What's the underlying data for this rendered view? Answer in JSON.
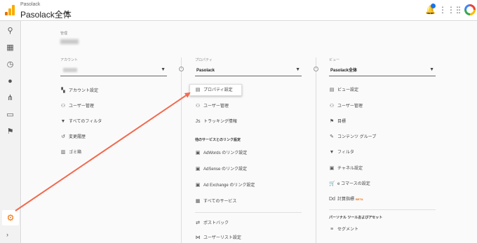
{
  "header": {
    "product_small": "Pasolack",
    "property_title": "Pasolack全体"
  },
  "admin": {
    "label": "管理"
  },
  "columns": {
    "account": {
      "heading": "アカウント",
      "items": [
        {
          "label": "アカウント設定",
          "icon": "building-icon"
        },
        {
          "label": "ユーザー管理",
          "icon": "users-icon"
        },
        {
          "label": "すべてのフィルタ",
          "icon": "filter-icon"
        },
        {
          "label": "変更履歴",
          "icon": "history-icon"
        },
        {
          "label": "ゴミ箱",
          "icon": "trash-icon"
        }
      ]
    },
    "property": {
      "heading": "プロパティ",
      "selected": "Pasolack",
      "items": [
        {
          "label": "プロパティ設定",
          "icon": "document-icon"
        },
        {
          "label": "ユーザー管理",
          "icon": "users-icon"
        },
        {
          "label": "トラッキング情報",
          "icon": "js-icon"
        }
      ],
      "links_heading": "他のサービスとのリンク設定",
      "links": [
        {
          "label": "AdWords のリンク設定",
          "icon": "adwords-icon"
        },
        {
          "label": "AdSense のリンク設定",
          "icon": "adsense-icon"
        },
        {
          "label": "Ad Exchange のリンク設定",
          "icon": "adexchange-icon"
        },
        {
          "label": "すべてのサービス",
          "icon": "apps-icon"
        }
      ],
      "more": [
        {
          "label": "ポストバック",
          "icon": "postback-icon"
        },
        {
          "label": "ユーザーリスト設定",
          "icon": "userlist-icon"
        }
      ]
    },
    "view": {
      "heading": "ビュー",
      "selected": "Pasolack全体",
      "items": [
        {
          "label": "ビュー設定",
          "icon": "doc-icon"
        },
        {
          "label": "ユーザー管理",
          "icon": "users-icon"
        },
        {
          "label": "目標",
          "icon": "flag-icon"
        },
        {
          "label": "コンテンツ グループ",
          "icon": "content-icon"
        },
        {
          "label": "フィルタ",
          "icon": "filter-icon"
        },
        {
          "label": "チャネル設定",
          "icon": "channel-icon"
        },
        {
          "label": "e コマースの設定",
          "icon": "cart-icon"
        },
        {
          "label": "計算指標",
          "icon": "calc-icon",
          "badge": "BETA"
        }
      ],
      "tools_heading": "パーソナル ツールおよびアセット",
      "tools": [
        {
          "label": "セグメント",
          "icon": "segment-icon"
        }
      ]
    }
  },
  "colors": {
    "accent_orange": "#e8710a",
    "arrow_red": "#f26a4f",
    "notification_blue": "#1a73e8"
  }
}
